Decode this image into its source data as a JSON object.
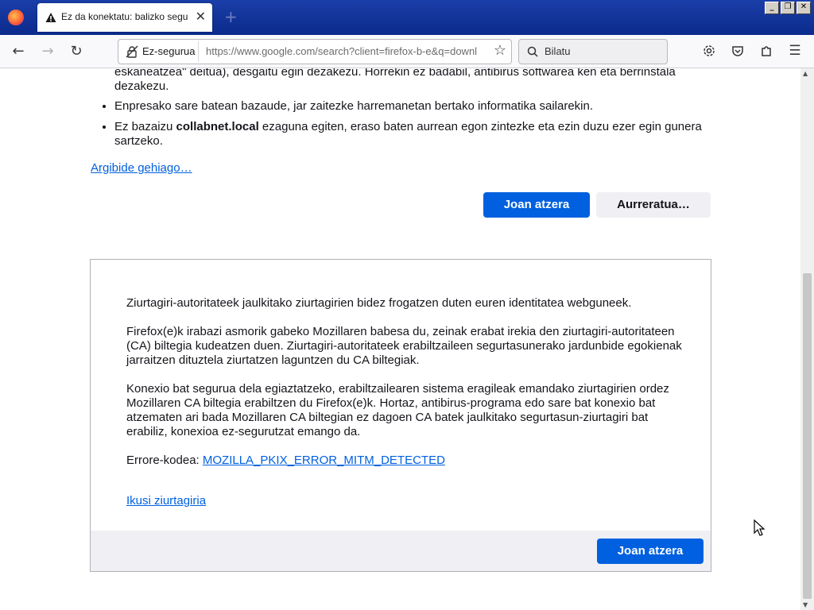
{
  "tab": {
    "title": "Ez da konektatu: balizko segurtasun",
    "close_glyph": "✕",
    "new_tab_glyph": "+"
  },
  "window_controls": {
    "minimize": "_",
    "restore": "❐",
    "close": "✕"
  },
  "toolbar": {
    "back_glyph": "←",
    "forward_glyph": "→",
    "reload_glyph": "↻",
    "insecure_label": "Ez-segurua",
    "url": "https://www.google.com/search?client=firefox-b-e&q=downl",
    "star_glyph": "☆",
    "search_placeholder": "Bilatu",
    "menu_glyph": "☰"
  },
  "page": {
    "fragment_text": "eskaneatzea\" deitua), desgaitu egin dezakezu. Horrekin ez badabil, antibirus softwarea ken eta berrinstala dezakezu.",
    "bullet1": "Enpresako sare batean bazaude, jar zaitezke harremanetan bertako informatika sailarekin.",
    "bullet2_prefix": "Ez bazaizu ",
    "bullet2_host": "collabnet.local",
    "bullet2_suffix": " ezaguna egiten, eraso baten aurrean egon zintezke eta ezin duzu ezer egin gunera sartzeko.",
    "learn_more": "Argibide gehiago…",
    "go_back": "Joan atzera",
    "advanced": "Aurreratua…"
  },
  "panel": {
    "p1": "Ziurtagiri-autoritateek jaulkitako ziurtagirien bidez frogatzen duten euren identitatea webguneek.",
    "p2": "Firefox(e)k irabazi asmorik gabeko Mozillaren babesa du, zeinak erabat irekia den ziurtagiri-autoritateen (CA) biltegia kudeatzen duen. Ziurtagiri-autoritateek erabiltzaileen segurtasunerako jardunbide egokienak jarraitzen dituztela ziurtatzen laguntzen du CA biltegiak.",
    "p3": "Konexio bat segurua dela egiaztatzeko, erabiltzailearen sistema eragileak emandako ziurtagirien ordez Mozillaren CA biltegia erabiltzen du Firefox(e)k. Hortaz, antibirus-programa edo sare bat konexio bat atzematen ari bada Mozillaren CA biltegian ez dagoen CA batek jaulkitako segurtasun-ziurtagiri bat erabiliz, konexioa ez-segurutzat emango da.",
    "error_label": "Errore-kodea: ",
    "error_code": "MOZILLA_PKIX_ERROR_MITM_DETECTED",
    "view_certificate": "Ikusi ziurtagiria",
    "go_back": "Joan atzera"
  },
  "colors": {
    "accent": "#0060df",
    "titlebar": "#0b2a8c"
  }
}
